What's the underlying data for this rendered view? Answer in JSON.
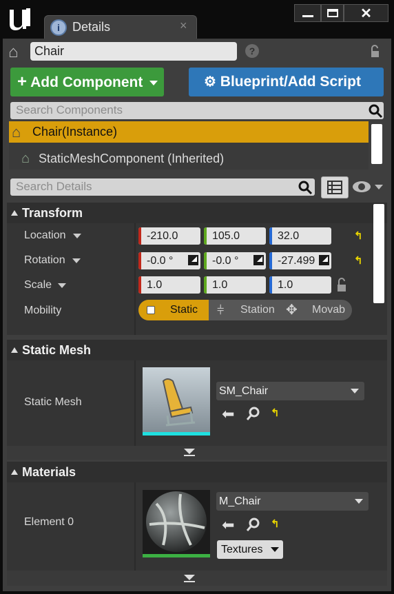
{
  "app": {
    "logo": "unreal-logo-icon",
    "tab_title": "Details",
    "tab_close": "×"
  },
  "window": {
    "min": "—",
    "restore": "▭",
    "close": "✕"
  },
  "actor": {
    "name": "Chair",
    "help": "?"
  },
  "buttons": {
    "add_component": "Add Component",
    "blueprint": "Blueprint/Add Script"
  },
  "search_components": {
    "placeholder": "Search Components"
  },
  "components": [
    {
      "label": "Chair(Instance)"
    },
    {
      "label": "StaticMeshComponent (Inherited)"
    }
  ],
  "search_details": {
    "placeholder": "Search Details"
  },
  "transform": {
    "title": "Transform",
    "location": {
      "label": "Location",
      "x": "-210.0",
      "y": "105.0",
      "z": "32.0"
    },
    "rotation": {
      "label": "Rotation",
      "x": "-0.0 °",
      "y": "-0.0 °",
      "z": "-27.499"
    },
    "scale": {
      "label": "Scale",
      "x": "1.0",
      "y": "1.0",
      "z": "1.0"
    },
    "mobility": {
      "label": "Mobility",
      "options": [
        "Static",
        "Station",
        "Movab"
      ],
      "selected": "Static"
    }
  },
  "static_mesh": {
    "title": "Static Mesh",
    "label": "Static Mesh",
    "asset": "SM_Chair"
  },
  "materials": {
    "title": "Materials",
    "element_label": "Element 0",
    "asset": "M_Chair",
    "textures": "Textures"
  },
  "colors": {
    "add": "#3c9a3c",
    "blueprint": "#2e77b8",
    "selected": "#d99e0b",
    "x": "#c0281b",
    "y": "#5fa91e",
    "z": "#2569d4",
    "reset": "#e8d400"
  }
}
